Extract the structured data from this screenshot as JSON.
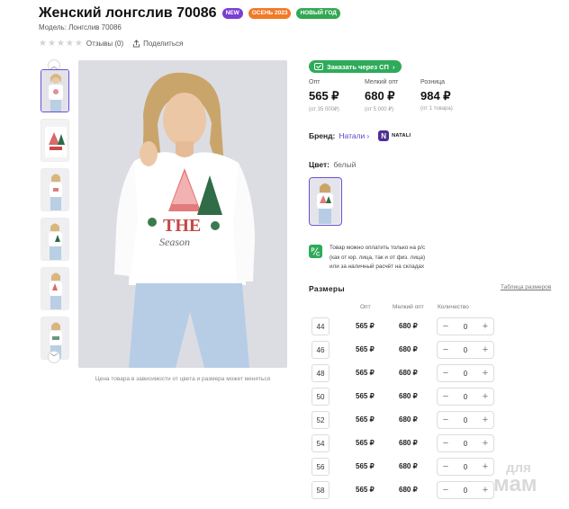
{
  "product": {
    "title": "Женский лонгслив 70086",
    "badges": [
      {
        "label": "NEW",
        "color": "#7a3fd1"
      },
      {
        "label": "ОСЕНЬ 2023",
        "color": "#f07a28"
      },
      {
        "label": "НОВЫЙ ГОД",
        "color": "#33a853"
      }
    ],
    "model": "Модель: Лонгслив 70086",
    "rating_stars": 0,
    "reviews_label": "Отзывы (0)",
    "share_label": "Поделиться"
  },
  "gallery": {
    "caption": "Цена товара в зависимости от цвета и размера может меняться",
    "thumbs_count": 6,
    "active_thumb": 0
  },
  "order": {
    "sp_button": "Заказать через СП"
  },
  "prices": [
    {
      "label": "Опт",
      "value": "565 ₽",
      "note": "(от 35 000₽)"
    },
    {
      "label": "Мелкий опт",
      "value": "680 ₽",
      "note": "(от 5 000 ₽)"
    },
    {
      "label": "Розница",
      "value": "984 ₽",
      "note": "(от 1 товара)"
    }
  ],
  "brand": {
    "label": "Бренд:",
    "value": "Натали",
    "logo_letter": "N",
    "logo_text": "NATALI"
  },
  "color": {
    "label": "Цвет:",
    "value": "белый"
  },
  "payment": {
    "icon": "Р/С",
    "lines": [
      "Товар можно оплатить только на р/с",
      "(как от юр. лица, так и от физ. лица)",
      "или за наличный расчёт на складах"
    ]
  },
  "sizes": {
    "title": "Размеры",
    "table_link": "Таблица размеров",
    "headers": {
      "opt": "Опт",
      "small_opt": "Мелкий опт",
      "qty": "Количество"
    },
    "rows": [
      {
        "size": "44",
        "opt": "565 ₽",
        "small_opt": "680 ₽",
        "qty": "0"
      },
      {
        "size": "46",
        "opt": "565 ₽",
        "small_opt": "680 ₽",
        "qty": "0"
      },
      {
        "size": "48",
        "opt": "565 ₽",
        "small_opt": "680 ₽",
        "qty": "0"
      },
      {
        "size": "50",
        "opt": "565 ₽",
        "small_opt": "680 ₽",
        "qty": "0"
      },
      {
        "size": "52",
        "opt": "565 ₽",
        "small_opt": "680 ₽",
        "qty": "0"
      },
      {
        "size": "54",
        "opt": "565 ₽",
        "small_opt": "680 ₽",
        "qty": "0"
      },
      {
        "size": "56",
        "opt": "565 ₽",
        "small_opt": "680 ₽",
        "qty": "0"
      },
      {
        "size": "58",
        "opt": "565 ₽",
        "small_opt": "680 ₽",
        "qty": "0"
      }
    ]
  },
  "watermark": {
    "line1": "для",
    "line2": "мам"
  }
}
